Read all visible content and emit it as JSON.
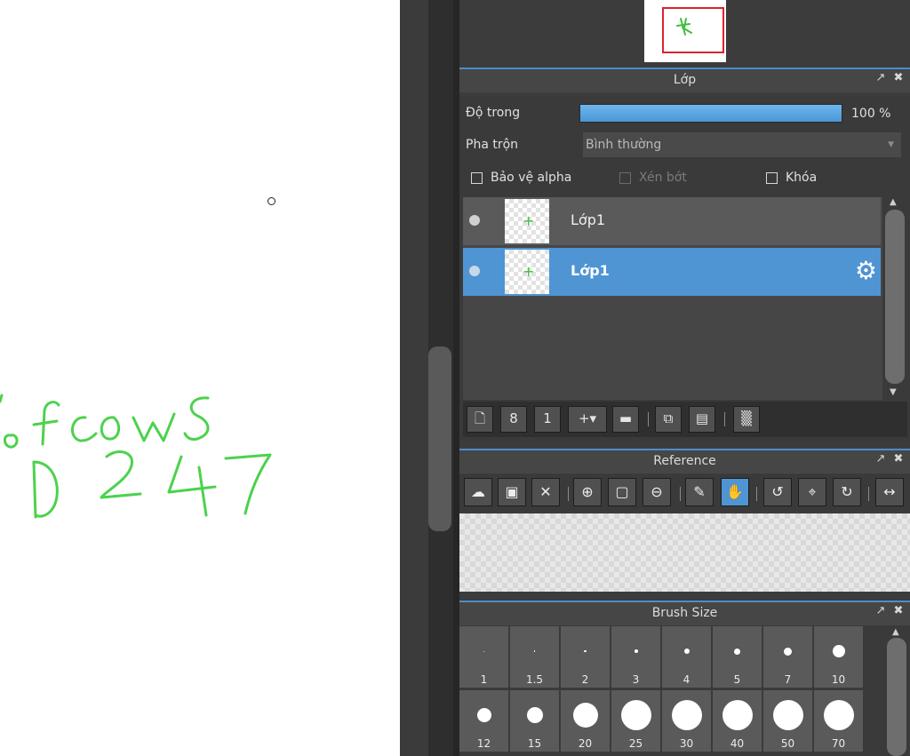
{
  "canvas": {
    "handwriting_line1": "ofcows",
    "handwriting_line2": "D247",
    "ink_color": "#4cd24c"
  },
  "layer_panel": {
    "title": "Lớp",
    "opacity_label": "Độ trong",
    "opacity_value": "100 %",
    "opacity": 1.0,
    "blend_label": "Pha trộn",
    "blend_value": "Bình thường",
    "protect_alpha_label": "Bảo vệ alpha",
    "clipping_label": "Xén bớt",
    "lock_label": "Khóa",
    "layers": [
      {
        "name": "Lớp1",
        "selected": false
      },
      {
        "name": "Lớp1",
        "selected": true
      }
    ]
  },
  "reference_panel": {
    "title": "Reference"
  },
  "brush_panel": {
    "title": "Brush Size",
    "sizes_row1": [
      "1",
      "1.5",
      "2",
      "3",
      "4",
      "5",
      "7",
      "10"
    ],
    "sizes_row2": [
      "12",
      "15",
      "20",
      "25",
      "30",
      "40",
      "50",
      "70"
    ]
  },
  "colors": {
    "accent": "#4f94d3",
    "panel_bg": "#3c3c3c",
    "nav_frame": "#d9242f"
  },
  "icons": {
    "panel_detach": "detach-icon",
    "panel_close": "close-icon",
    "gear": "gear-icon"
  }
}
